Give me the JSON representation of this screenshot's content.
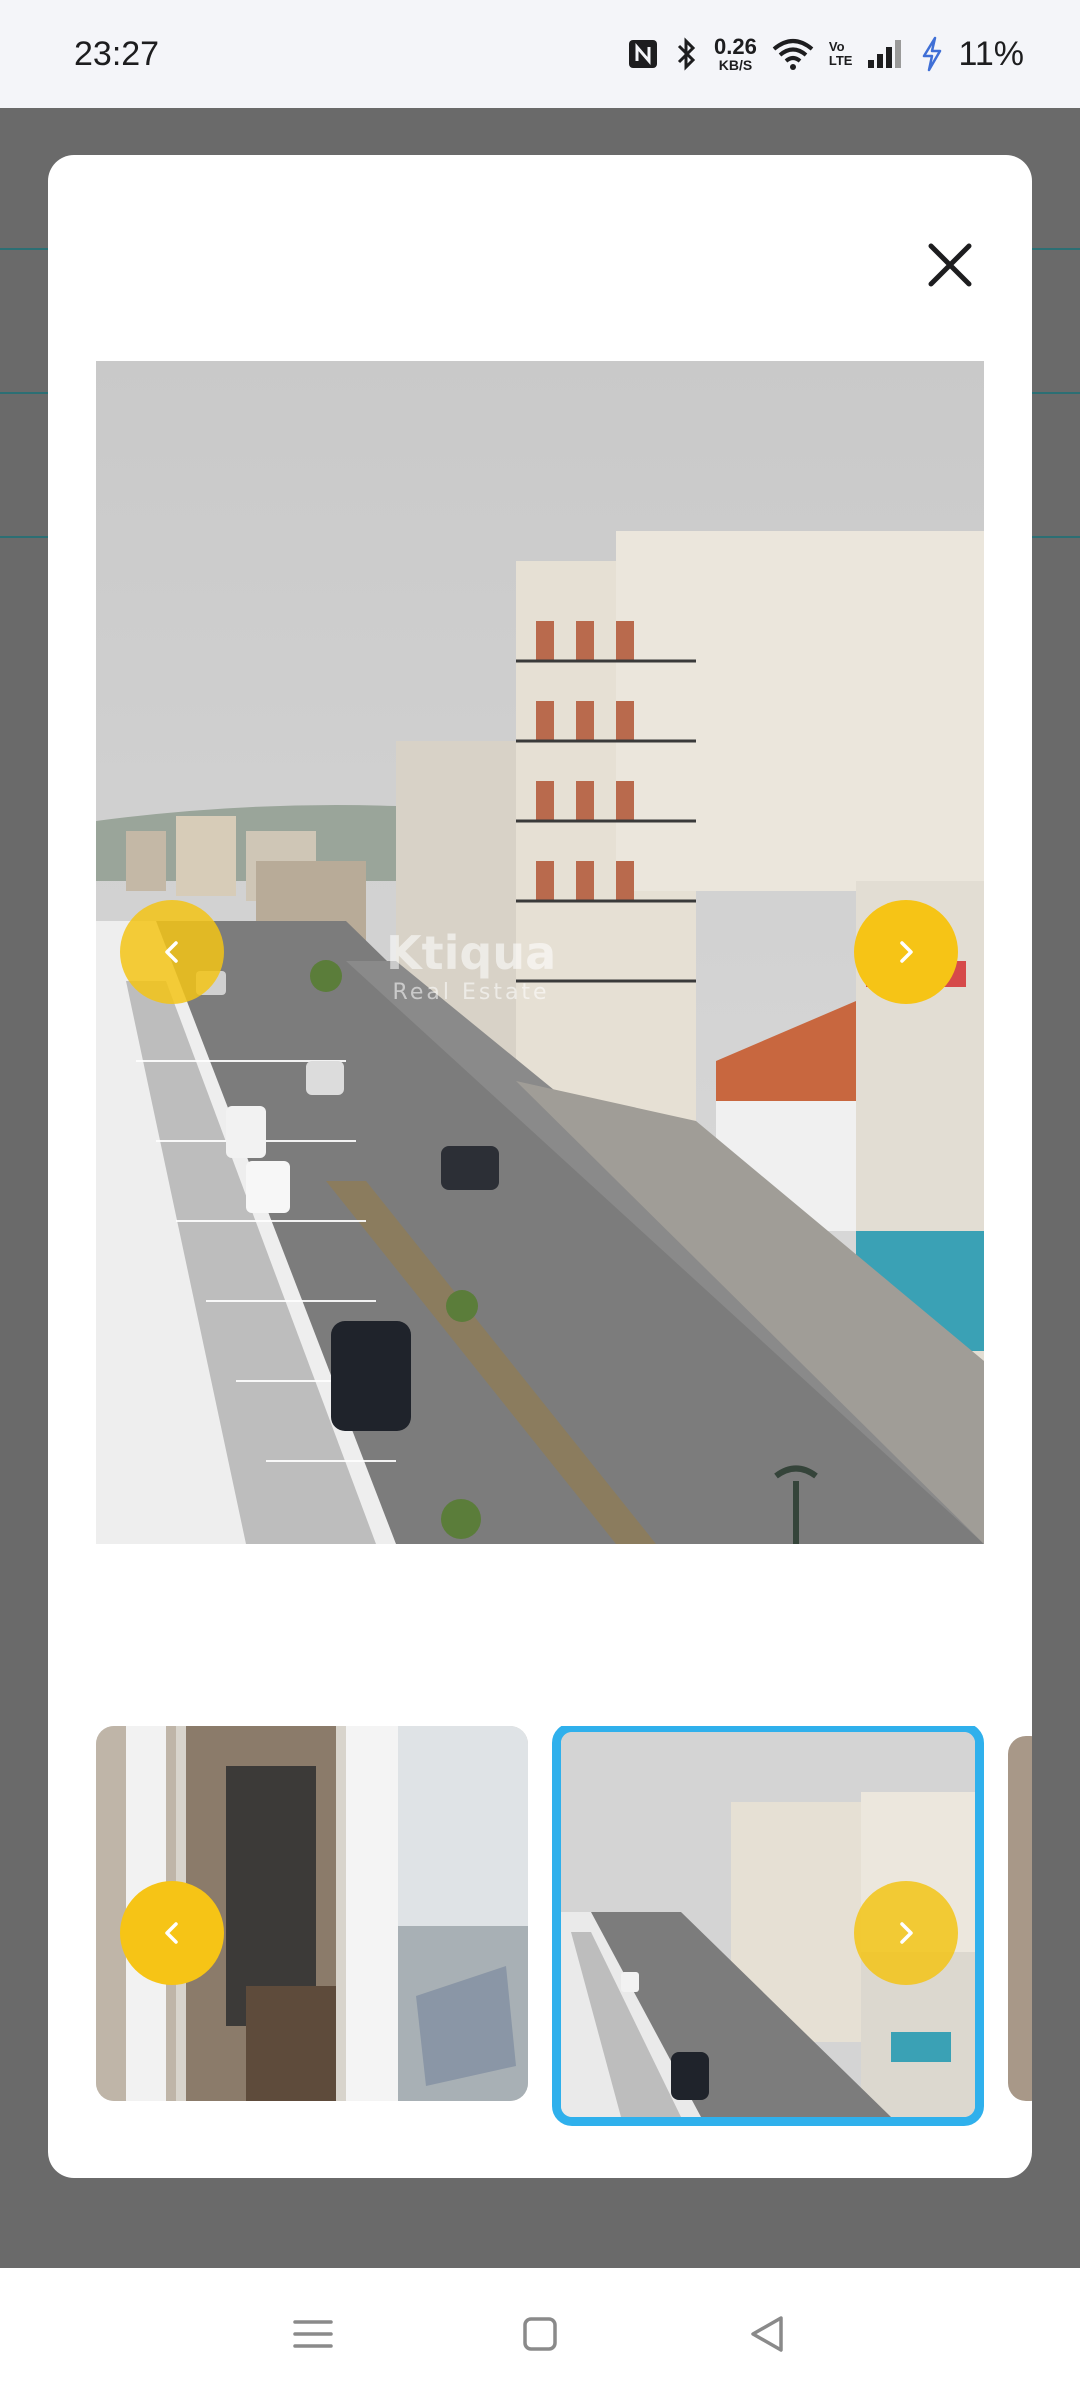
{
  "status_bar": {
    "time": "23:27",
    "net_speed_value": "0.26",
    "net_speed_unit": "KB/S",
    "volte_top": "Vo",
    "volte_bottom": "LTE",
    "battery_percent": "11%"
  },
  "gallery": {
    "close_icon": "close-icon",
    "prev_icon": "chevron-left-icon",
    "next_icon": "chevron-right-icon",
    "watermark_brand": "Ktiqua",
    "watermark_sub": "Real Estate",
    "main_photo_subject": "street view from balcony",
    "thumbnails": [
      {
        "subject": "interior doorway with balcony view",
        "selected": false
      },
      {
        "subject": "street view from balcony",
        "selected": true
      }
    ],
    "colors": {
      "arrow": "#f6c416",
      "selected_border": "#2fb0ec"
    }
  },
  "nav_bar": {
    "menu_icon": "menu-icon",
    "home_icon": "home-icon",
    "back_icon": "back-icon"
  }
}
